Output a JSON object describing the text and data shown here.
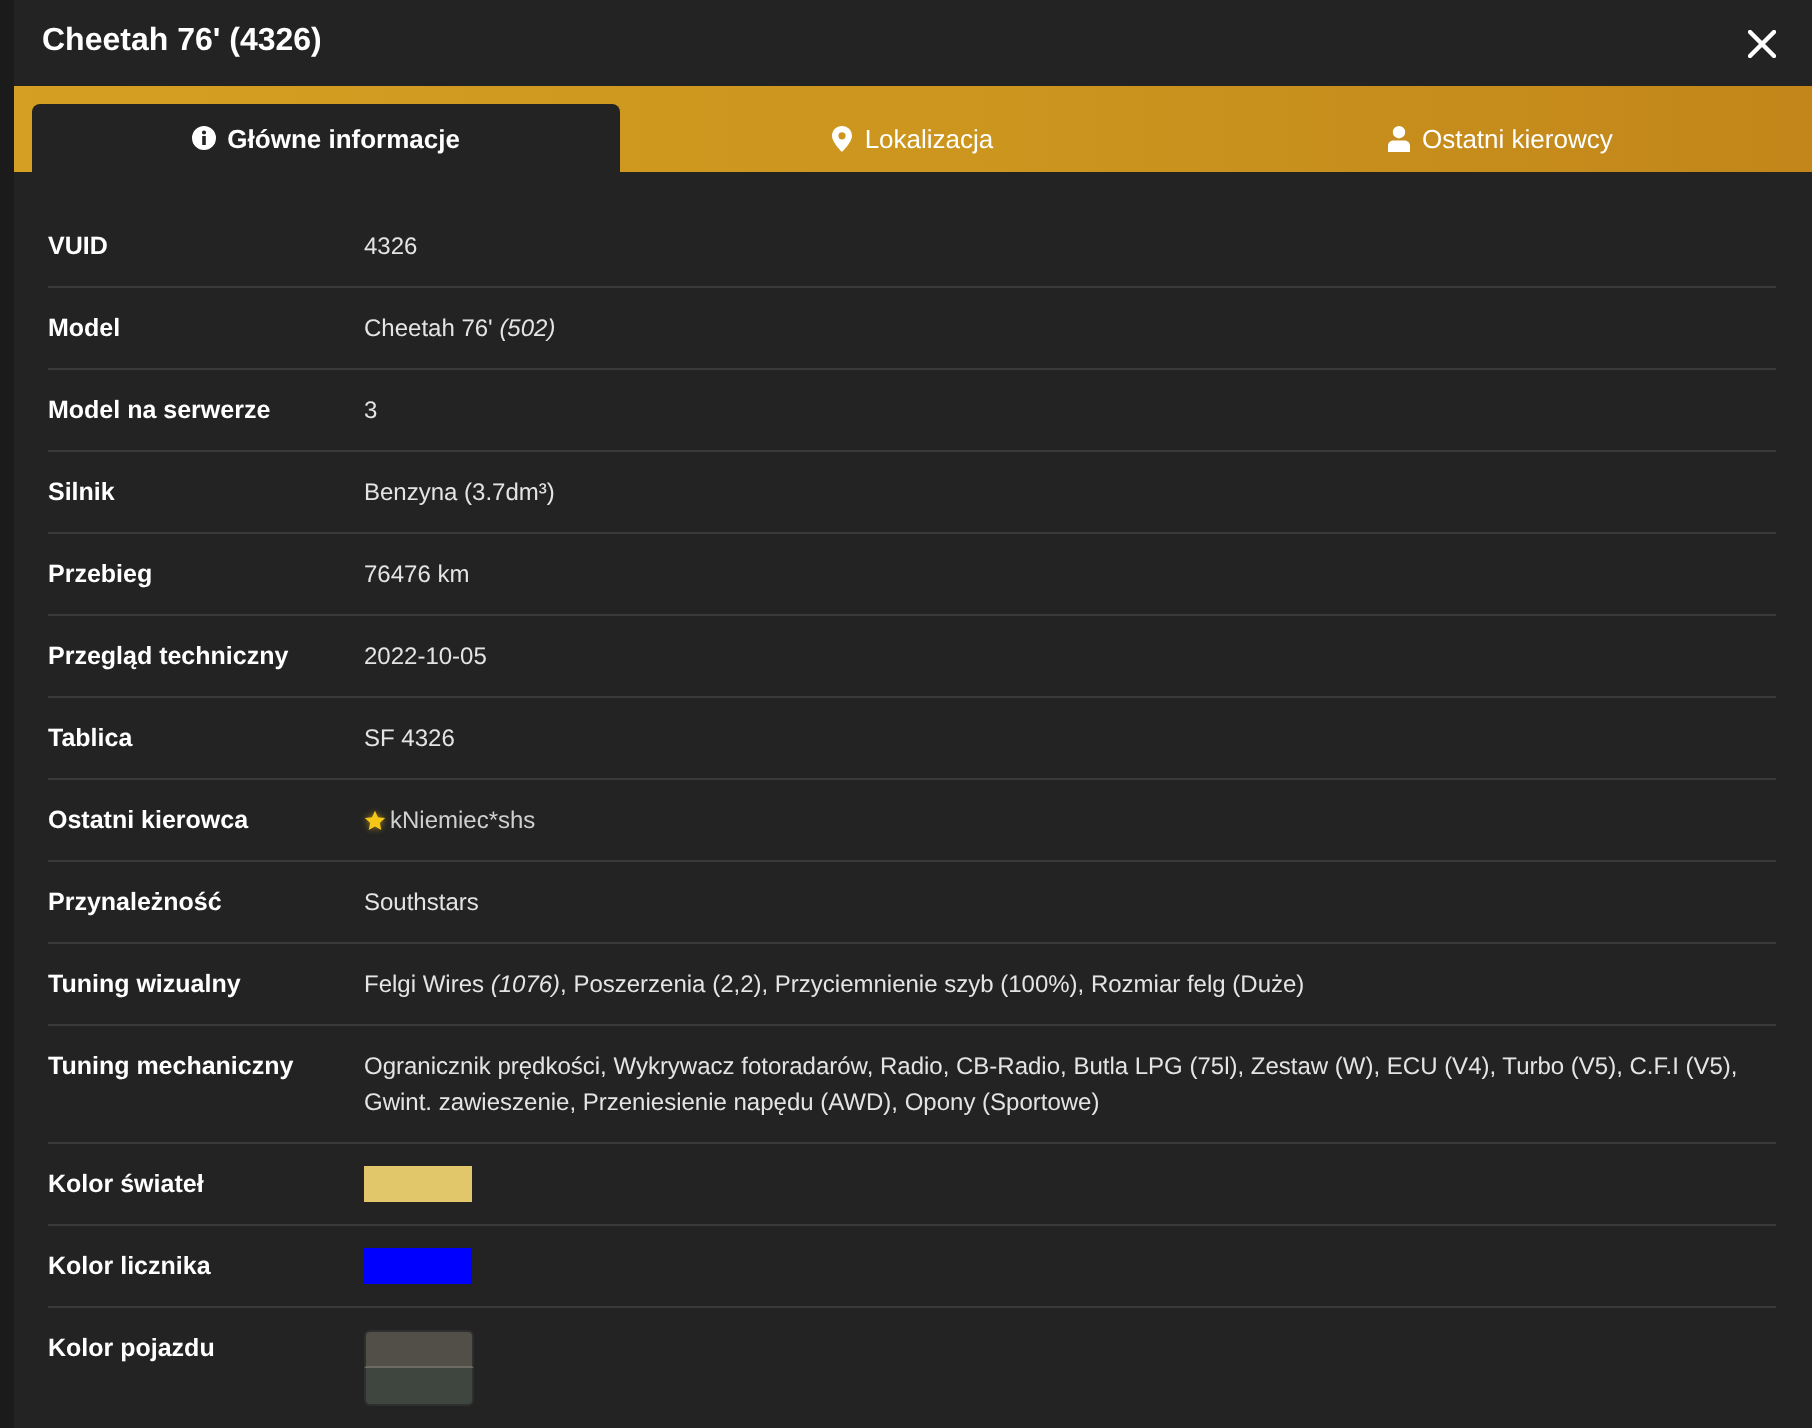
{
  "window": {
    "title": "Cheetah 76' (4326)"
  },
  "tabs": [
    {
      "label": "Główne informacje",
      "selected": true
    },
    {
      "label": "Lokalizacja",
      "selected": false
    },
    {
      "label": "Ostatni kierowcy",
      "selected": false
    }
  ],
  "rows": [
    {
      "kind": "text",
      "label": "VUID",
      "value": "4326"
    },
    {
      "kind": "text",
      "label": "Model",
      "value": "Cheetah 76' *(502)*"
    },
    {
      "kind": "text",
      "label": "Model na serwerze",
      "value": "3"
    },
    {
      "kind": "text",
      "label": "Silnik",
      "value": "Benzyna (3.7dm³)"
    },
    {
      "kind": "text",
      "label": "Przebieg",
      "value": "76476 km"
    },
    {
      "kind": "text",
      "label": "Przegląd techniczny",
      "value": "2022-10-05"
    },
    {
      "kind": "text",
      "label": "Tablica",
      "value": "SF 4326"
    },
    {
      "kind": "driver",
      "label": "Ostatni kierowca",
      "value": "kNiemiec*shs"
    },
    {
      "kind": "text",
      "label": "Przynależność",
      "value": "Southstars"
    },
    {
      "kind": "text",
      "label": "Tuning wizualny",
      "value": "Felgi Wires *(1076)*, Poszerzenia (2,2), Przyciemnienie szyb (100%), Rozmiar felg (Duże)"
    },
    {
      "kind": "text",
      "label": "Tuning mechaniczny",
      "value": "Ogranicznik prędkości, Wykrywacz fotoradarów, Radio, CB-Radio, Butla LPG (75l), Zestaw (W), ECU (V4), Turbo (V5), C.F.I (V5), Gwint. zawieszenie, Przeniesienie napędu (AWD), Opony (Sportowe)"
    },
    {
      "kind": "swatch",
      "label": "Kolor świateł",
      "color": "#e2c76a"
    },
    {
      "kind": "swatch",
      "label": "Kolor licznika",
      "color": "#0000ff"
    },
    {
      "kind": "swatches",
      "label": "Kolor pojazdu",
      "swatches": [
        {
          "color": "#524e48"
        },
        {
          "color": "#3f463f"
        }
      ]
    }
  ]
}
